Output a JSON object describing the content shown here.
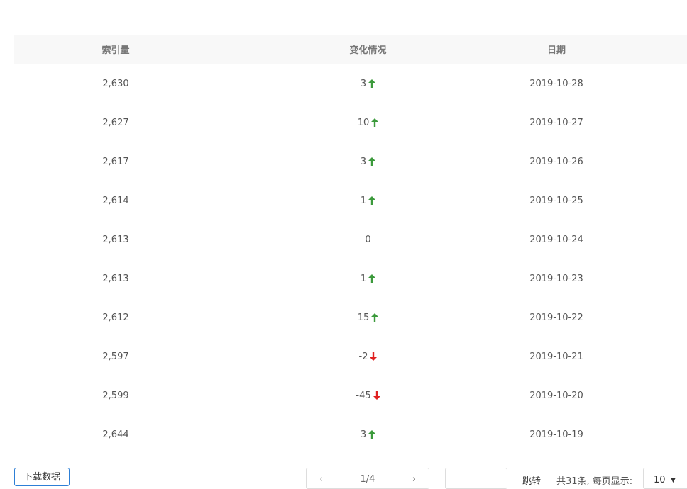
{
  "table": {
    "headers": [
      "索引量",
      "变化情况",
      "日期"
    ],
    "rows": [
      {
        "index": "2,630",
        "change": "3",
        "dir": "up",
        "date": "2019-10-28"
      },
      {
        "index": "2,627",
        "change": "10",
        "dir": "up",
        "date": "2019-10-27"
      },
      {
        "index": "2,617",
        "change": "3",
        "dir": "up",
        "date": "2019-10-26"
      },
      {
        "index": "2,614",
        "change": "1",
        "dir": "up",
        "date": "2019-10-25"
      },
      {
        "index": "2,613",
        "change": "0",
        "dir": "none",
        "date": "2019-10-24"
      },
      {
        "index": "2,613",
        "change": "1",
        "dir": "up",
        "date": "2019-10-23"
      },
      {
        "index": "2,612",
        "change": "15",
        "dir": "up",
        "date": "2019-10-22"
      },
      {
        "index": "2,597",
        "change": "-2",
        "dir": "down",
        "date": "2019-10-21"
      },
      {
        "index": "2,599",
        "change": "-45",
        "dir": "down",
        "date": "2019-10-20"
      },
      {
        "index": "2,644",
        "change": "3",
        "dir": "up",
        "date": "2019-10-19"
      }
    ]
  },
  "colors": {
    "up": "#3c9a3c",
    "down": "#e02020"
  },
  "footer": {
    "download_label": "下载数据",
    "pager": {
      "prev_icon": "‹",
      "info": "1/4",
      "next_icon": "›"
    },
    "goto_label": "跳转",
    "total_label": "共31条, 每页显示:",
    "page_size": "10"
  }
}
